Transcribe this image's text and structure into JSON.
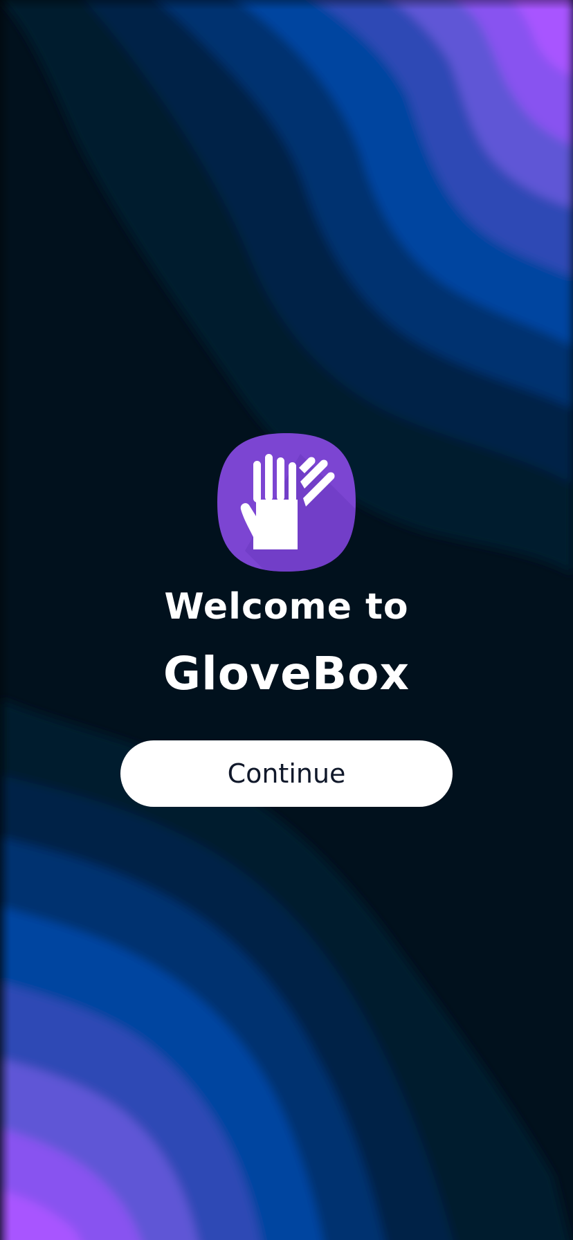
{
  "welcome": {
    "greeting": "Welcome to",
    "app_name": "GloveBox",
    "continue_label": "Continue"
  },
  "icons": {
    "app_logo": "glove-icon"
  },
  "colors": {
    "background_dark": "#01111d",
    "wave_navy": "#022447",
    "wave_blue": "#0244a0",
    "wave_indigo": "#3a4bc3",
    "wave_purple": "#9a55ff",
    "logo_purple": "#7c45d2",
    "button_bg": "#ffffff",
    "button_text": "#10182a"
  }
}
